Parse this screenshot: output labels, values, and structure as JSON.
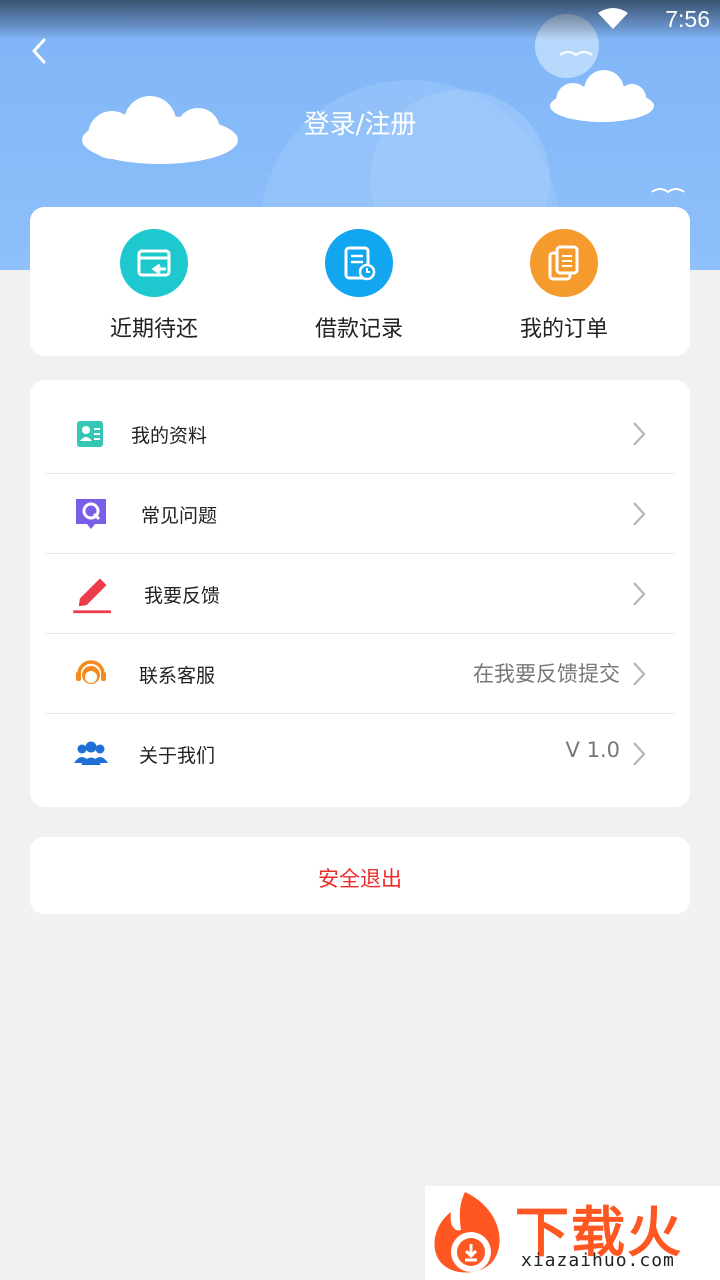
{
  "status_bar": {
    "time": "7:56"
  },
  "header": {
    "title": "登录/注册"
  },
  "quick_actions": [
    {
      "label": "近期待还",
      "icon": "repay-card-icon",
      "color": "#1ec8cf"
    },
    {
      "label": "借款记录",
      "icon": "loan-record-icon",
      "color": "#12a5f0"
    },
    {
      "label": "我的订单",
      "icon": "order-copy-icon",
      "color": "#f59a2c"
    }
  ],
  "menu": [
    {
      "label": "我的资料",
      "value": "",
      "icon": "profile-card-icon"
    },
    {
      "label": "常见问题",
      "value": "",
      "icon": "faq-q-icon"
    },
    {
      "label": "我要反馈",
      "value": "",
      "icon": "feedback-pencil-icon"
    },
    {
      "label": "联系客服",
      "value": "在我要反馈提交",
      "icon": "customer-service-icon"
    },
    {
      "label": "关于我们",
      "value": "V 1.0",
      "icon": "about-team-icon"
    }
  ],
  "logout": {
    "label": "安全退出"
  },
  "watermark": {
    "brand_cn": "下载火",
    "brand_en": "xiazaihuo.com"
  },
  "colors": {
    "header_blue": "#86baf8",
    "logout_red": "#ee2b2b",
    "watermark_orange": "#ff5722"
  }
}
